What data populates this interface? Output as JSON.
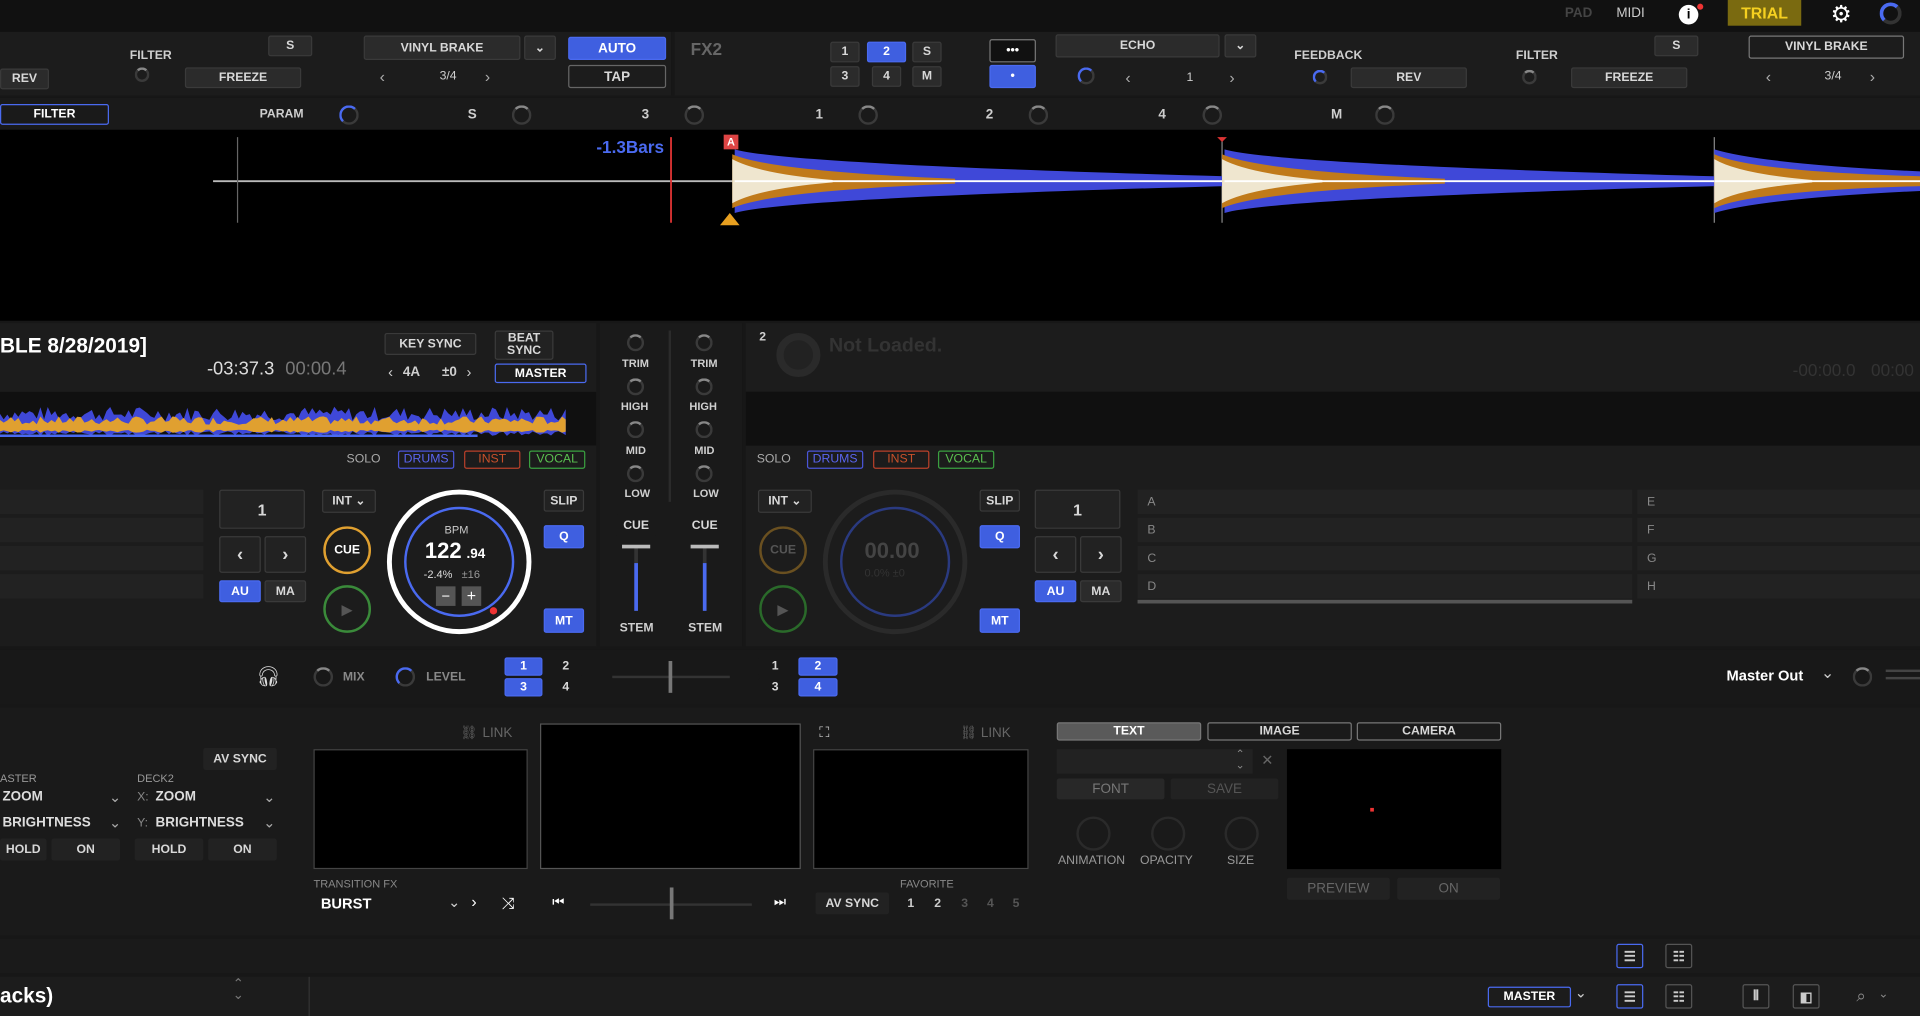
{
  "topbar": {
    "pad": "PAD",
    "midi": "MIDI",
    "trial": "TRIAL"
  },
  "fx1": {
    "filter": "FILTER",
    "s": "S",
    "rev": "REV",
    "freeze": "FREEZE",
    "effect": "VINYL BRAKE",
    "beat": "3/4",
    "auto": "AUTO",
    "tap": "TAP"
  },
  "fx2": {
    "label": "FX2",
    "n1": "1",
    "n2": "2",
    "s": "S",
    "n3": "3",
    "n4": "4",
    "m": "M",
    "dots": "•••",
    "dot": "•",
    "effect": "ECHO",
    "value": "1",
    "feedback": "FEEDBACK",
    "rev": "REV",
    "filter": "FILTER",
    "s2": "S",
    "freeze": "FREEZE",
    "effect2": "VINYL BRAKE",
    "beat2": "3/4"
  },
  "paramrow": {
    "filter": "FILTER",
    "param": "PARAM",
    "s": "S",
    "n3": "3",
    "n1": "1",
    "n2": "2",
    "n4": "4",
    "m": "M"
  },
  "waveform": {
    "bars": "-1.3Bars",
    "marker": "A"
  },
  "deck1": {
    "title": "BLE 8/28/2019]",
    "remain": "-03:37.3",
    "elapsed": "00:00.4",
    "keysync": "KEY SYNC",
    "beatsync": "BEAT SYNC",
    "key": "4A",
    "keyshift": "±0",
    "master": "MASTER",
    "solo": "SOLO",
    "drums": "DRUMS",
    "inst": "INST",
    "vocal": "VOCAL",
    "beatjump": "1",
    "int": "INT",
    "slip": "SLIP",
    "cue": "CUE",
    "q": "Q",
    "au": "AU",
    "ma": "MA",
    "mt": "MT",
    "bpm_label": "BPM",
    "bpm": "122",
    "bpm_dec": ".94",
    "pitch": "-2.4%",
    "range": "±16",
    "minus": "−",
    "plus": "+"
  },
  "mixer": {
    "trim": "TRIM",
    "high": "HIGH",
    "mid": "MID",
    "low": "LOW",
    "cue": "CUE",
    "stem": "STEM"
  },
  "deck2": {
    "num": "2",
    "status": "Not Loaded.",
    "time1": "-00:00.0",
    "time2": "00:00",
    "solo": "SOLO",
    "drums": "DRUMS",
    "inst": "INST",
    "vocal": "VOCAL",
    "int": "INT",
    "slip": "SLIP",
    "cue": "CUE",
    "q": "Q",
    "au": "AU",
    "ma": "MA",
    "mt": "MT",
    "beatjump": "1",
    "bpm": "00.00",
    "pitch": "0.0% ±0"
  },
  "hotcues": [
    "A",
    "B",
    "C",
    "D",
    "E",
    "F",
    "G",
    "H"
  ],
  "midbar": {
    "mix": "MIX",
    "level": "LEVEL",
    "a1": "1",
    "a2": "2",
    "a3": "3",
    "a4": "4",
    "b1": "1",
    "b2": "2",
    "b3": "3",
    "b4": "4",
    "masterout": "Master Out"
  },
  "video": {
    "avsync": "AV SYNC",
    "master": "ASTER",
    "deck2": "DECK2",
    "zoom": "ZOOM",
    "x": "X:",
    "zoom2": "ZOOM",
    "brightness": "BRIGHTNESS",
    "y": "Y:",
    "brightness2": "BRIGHTNESS",
    "hold": "HOLD",
    "on": "ON",
    "hold2": "HOLD",
    "on2": "ON",
    "link": "LINK",
    "link2": "LINK",
    "transition_label": "TRANSITION FX",
    "transition": "BURST",
    "avsync2": "AV SYNC",
    "favorite": "FAVORITE",
    "fav": [
      "1",
      "2",
      "3",
      "4",
      "5"
    ],
    "tab_text": "TEXT",
    "tab_image": "IMAGE",
    "tab_camera": "CAMERA",
    "font": "FONT",
    "save": "SAVE",
    "animation": "ANIMATION",
    "opacity": "OPACITY",
    "size": "SIZE",
    "preview": "PREVIEW",
    "on3": "ON"
  },
  "bottom": {
    "playlist": "acks)",
    "master": "MASTER"
  }
}
